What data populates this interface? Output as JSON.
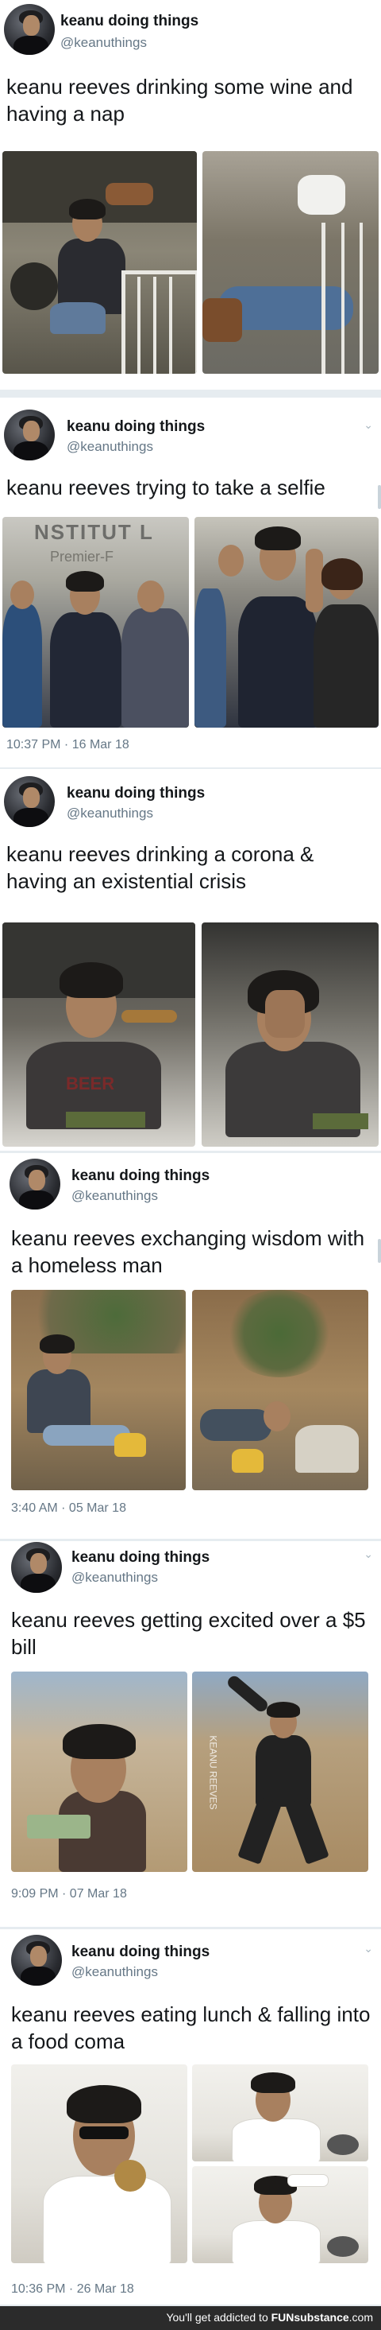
{
  "tweets": [
    {
      "name": "keanu doing things",
      "handle": "@keanuthings",
      "text": "keanu reeves drinking some wine and having a nap",
      "time": ""
    },
    {
      "name": "keanu doing things",
      "handle": "@keanuthings",
      "text": "keanu reeves trying to take a selfie",
      "time": "10:37 PM · 16 Mar 18"
    },
    {
      "name": "keanu doing things",
      "handle": "@keanuthings",
      "text": "keanu reeves drinking a corona & having an existential crisis",
      "time": ""
    },
    {
      "name": "keanu doing things",
      "handle": "@keanuthings",
      "text": "keanu reeves exchanging wisdom with a homeless man",
      "time": "3:40 AM · 05 Mar 18"
    },
    {
      "name": "keanu doing things",
      "handle": "@keanuthings",
      "text": "keanu reeves getting excited over a $5 bill",
      "time": "9:09 PM · 07 Mar 18"
    },
    {
      "name": "keanu doing things",
      "handle": "@keanuthings",
      "text": "keanu reeves eating lunch & falling into a food coma",
      "time": "10:36 PM · 26 Mar 18"
    }
  ],
  "photo_signs": {
    "institut": "NSTITUT L",
    "premier": "Premier-F",
    "beer_sign": "BEER",
    "watermark": "KEANU REEVES"
  },
  "footer": {
    "text": "You'll get addicted to",
    "brand": "FUNsubstance",
    "domain": ".com"
  },
  "icons": {
    "chevron": "chevron-down-icon"
  },
  "colors": {
    "name": "#14171a",
    "secondary": "#657786",
    "background": "#e6ecf0",
    "card": "#ffffff"
  }
}
